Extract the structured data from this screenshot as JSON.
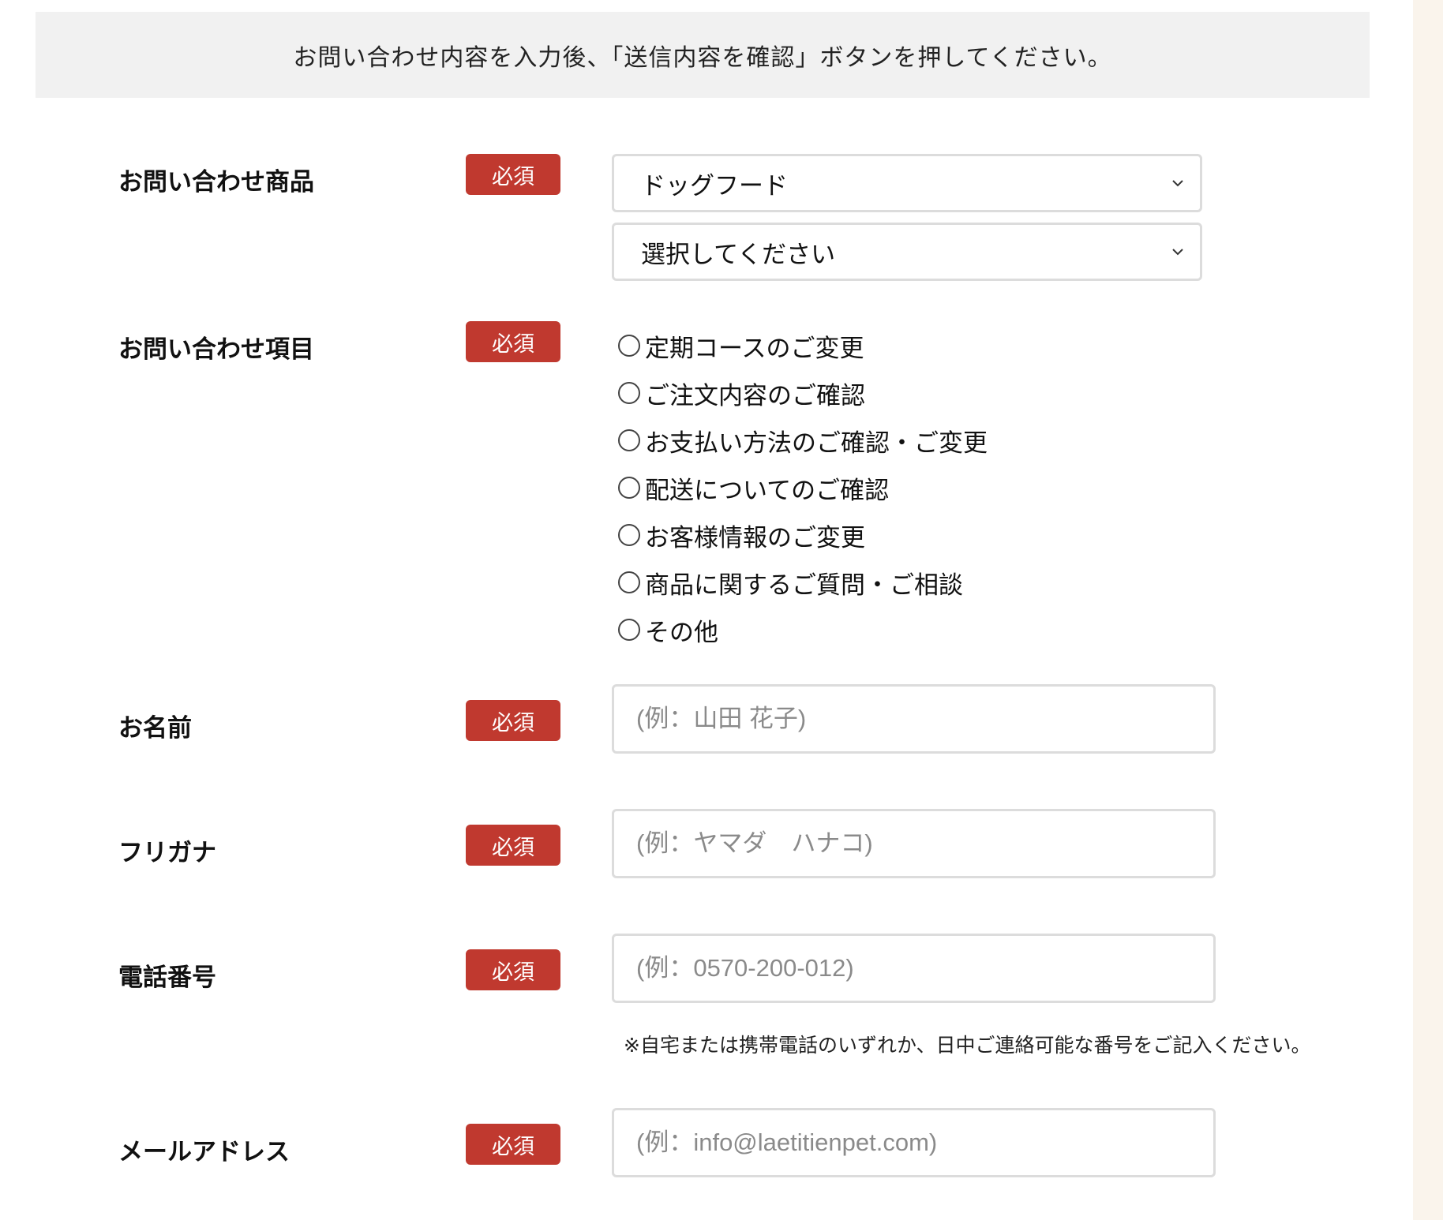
{
  "notice": "お問い合わせ内容を入力後、「送信内容を確認」ボタンを押してください。",
  "required_label": "必須",
  "product": {
    "label": "お問い合わせ商品",
    "select1_value": "ドッグフード",
    "select2_value": "選択してください"
  },
  "inquiry": {
    "label": "お問い合わせ項目",
    "options": [
      "定期コースのご変更",
      "ご注文内容のご確認",
      "お支払い方法のご確認・ご変更",
      "配送についてのご確認",
      "お客様情報のご変更",
      "商品に関するご質問・ご相談",
      "その他"
    ]
  },
  "name": {
    "label": "お名前",
    "placeholder": "(例：山田 花子)"
  },
  "furigana": {
    "label": "フリガナ",
    "placeholder": "(例：ヤマダ　ハナコ)"
  },
  "phone": {
    "label": "電話番号",
    "placeholder": "(例：0570-200-012)",
    "note": "※自宅または携帯電話のいずれか、日中ご連絡可能な番号をご記入ください。"
  },
  "email": {
    "label": "メールアドレス",
    "placeholder": "(例：info@laetitienpet.com)"
  },
  "colors": {
    "required_badge": "#c0392f",
    "notice_bg": "#f1f1f1",
    "side_strip": "#faf4ec"
  }
}
